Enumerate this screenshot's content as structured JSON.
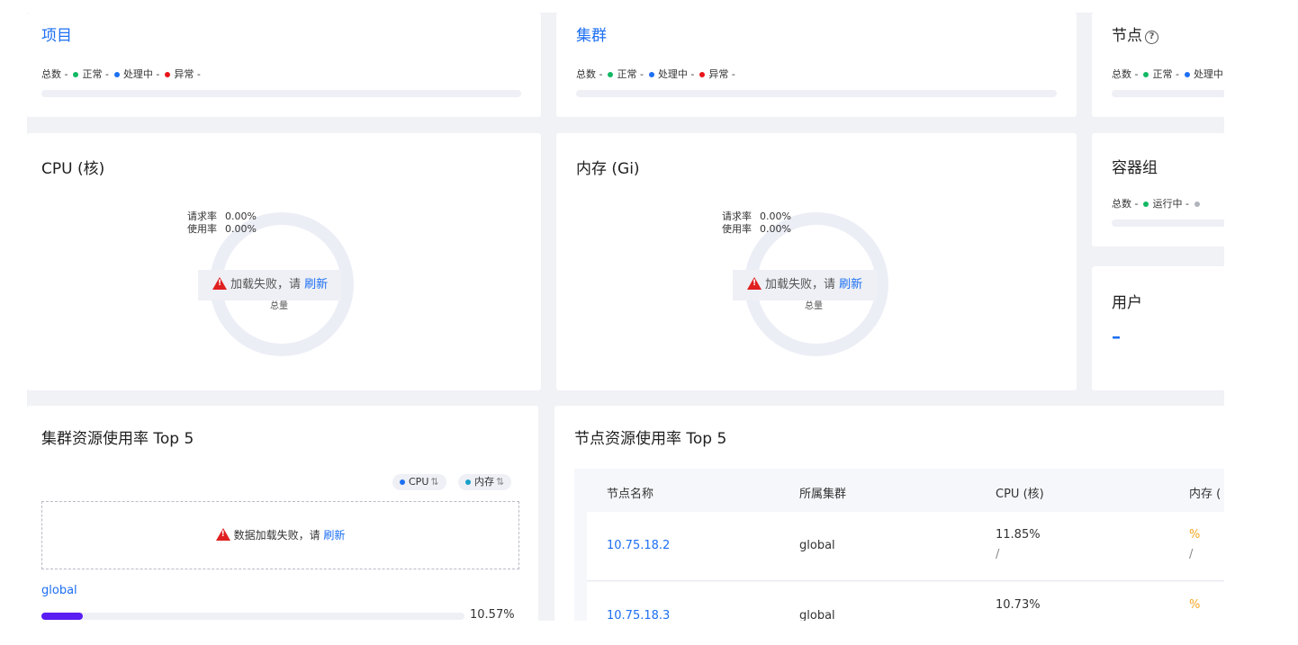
{
  "colors": {
    "blue": "#1d6ff2",
    "green": "#12b864",
    "red": "#e8151a",
    "grey": "#b0b3bb",
    "orange": "#f5a623",
    "purple": "#5a1df2"
  },
  "projects": {
    "title": "项目",
    "total": "总数 -",
    "normal": "正常 -",
    "processing": "处理中 -",
    "abnormal": "异常 -"
  },
  "clusters": {
    "title": "集群",
    "total": "总数 -",
    "normal": "正常 -",
    "processing": "处理中 -",
    "abnormal": "异常 -"
  },
  "nodes": {
    "title": "节点",
    "total": "总数 -",
    "normal": "正常 -",
    "processing": "处理中"
  },
  "cpu": {
    "title": "CPU (核)",
    "request_label": "请求率",
    "request_value": "0.00%",
    "usage_label": "使用率",
    "usage_value": "0.00%",
    "error_text": "加载失败，请",
    "refresh": "刷新",
    "total_label": "总量"
  },
  "memory": {
    "title": "内存 (Gi)",
    "request_label": "请求率",
    "request_value": "0.00%",
    "usage_label": "使用率",
    "usage_value": "0.00%",
    "error_text": "加载失败，请",
    "refresh": "刷新",
    "total_label": "总量"
  },
  "pods": {
    "title": "容器组",
    "total": "总数 -",
    "running": "运行中 -"
  },
  "users": {
    "title": "用户",
    "value": "–"
  },
  "cluster_top5": {
    "title": "集群资源使用率 Top 5",
    "sort_cpu": "CPU",
    "sort_memory": "内存",
    "error_text": "数据加载失败，请",
    "refresh": "刷新",
    "items": [
      {
        "name": "global",
        "value": "10.57%",
        "ratio": 0.1057
      }
    ]
  },
  "node_top5": {
    "title": "节点资源使用率 Top 5",
    "columns": [
      "节点名称",
      "所属集群",
      "CPU (核)",
      "内存 ("
    ],
    "rows": [
      {
        "name": "10.75.18.2",
        "cluster": "global",
        "cpu": "11.85%",
        "cpu_sub": "/",
        "mem": "%",
        "mem_sub": "/"
      },
      {
        "name": "10.75.18.3",
        "cluster": "global",
        "cpu": "10.73%",
        "cpu_sub": "",
        "mem": "%",
        "mem_sub": ""
      }
    ]
  }
}
